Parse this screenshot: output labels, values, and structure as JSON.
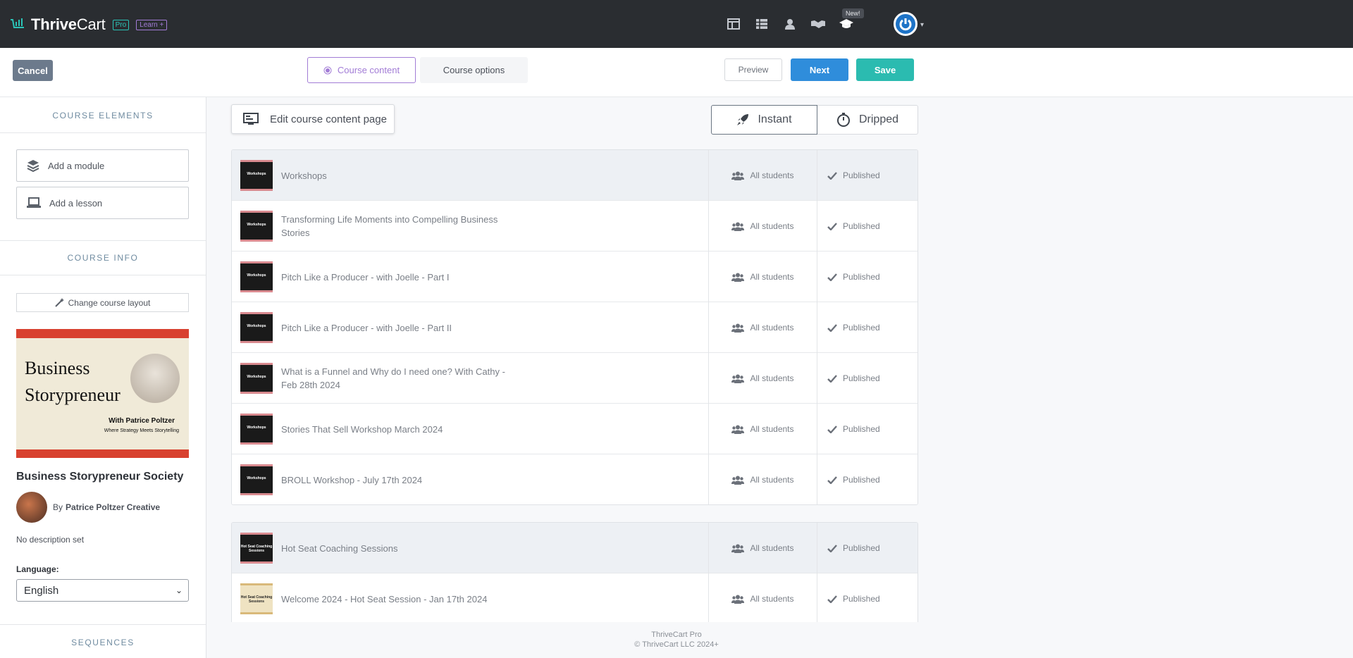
{
  "brand": {
    "name_a": "Thrive",
    "name_b": "Cart",
    "pro": "Pro",
    "learn": "Learn +",
    "accent": "#2bc4b7",
    "purple": "#a27cd6"
  },
  "topnav": {
    "icons": [
      "layout-icon",
      "table-icon",
      "user-icon",
      "handshake-icon",
      "graduation-cap-icon"
    ],
    "new_badge": "New!"
  },
  "actions": {
    "cancel": "Cancel",
    "tab_content": "Course content",
    "tab_options": "Course options",
    "preview": "Preview",
    "next": "Next",
    "save": "Save"
  },
  "sidebar": {
    "course_elements": "COURSE ELEMENTS",
    "add_module": "Add a module",
    "add_lesson": "Add a lesson",
    "course_info": "COURSE INFO",
    "change_layout": "Change course layout",
    "image": {
      "line1": "Business",
      "line2": "Storypreneur",
      "with": "With Patrice Poltzer",
      "tagline": "Where Strategy Meets Storytelling"
    },
    "course_title": "Business Storypreneur Society",
    "by": "By",
    "author": "Patrice Poltzer Creative",
    "description": "No description set",
    "language_label": "Language:",
    "language_value": "English",
    "sequences": "SEQUENCES"
  },
  "main": {
    "edit_page": "Edit course content page",
    "instant": "Instant",
    "dripped": "Dripped",
    "groups": [
      {
        "rows": [
          {
            "title": "Workshops",
            "thumb": "Workshops",
            "students": "All students",
            "status": "Published",
            "head": true
          },
          {
            "title": "Transforming Life Moments into Compelling Business Stories",
            "thumb": "Workshops",
            "students": "All students",
            "status": "Published"
          },
          {
            "title": "Pitch Like a Producer - with Joelle - Part I",
            "thumb": "Workshops",
            "students": "All students",
            "status": "Published"
          },
          {
            "title": "Pitch Like a Producer - with Joelle - Part II",
            "thumb": "Workshops",
            "students": "All students",
            "status": "Published"
          },
          {
            "title": "What is a Funnel and Why do I need one? With Cathy - Feb 28th 2024",
            "thumb": "Workshops",
            "students": "All students",
            "status": "Published"
          },
          {
            "title": "Stories That Sell Workshop March 2024",
            "thumb": "Workshops",
            "students": "All students",
            "status": "Published"
          },
          {
            "title": "BROLL Workshop - July 17th 2024",
            "thumb": "Workshops",
            "students": "All students",
            "status": "Published"
          }
        ]
      },
      {
        "rows": [
          {
            "title": "Hot Seat Coaching Sessions",
            "thumb": "Hot Seat Coaching Sessions",
            "students": "All students",
            "status": "Published",
            "head": true
          },
          {
            "title": "Welcome 2024 - Hot Seat Session - Jan 17th 2024",
            "thumb": "Hot Seat Coaching Sessions",
            "students": "All students",
            "status": "Published",
            "tan": true
          }
        ]
      }
    ]
  },
  "footer": {
    "line1": "ThriveCart Pro",
    "line2": "© ThriveCart LLC 2024+"
  }
}
